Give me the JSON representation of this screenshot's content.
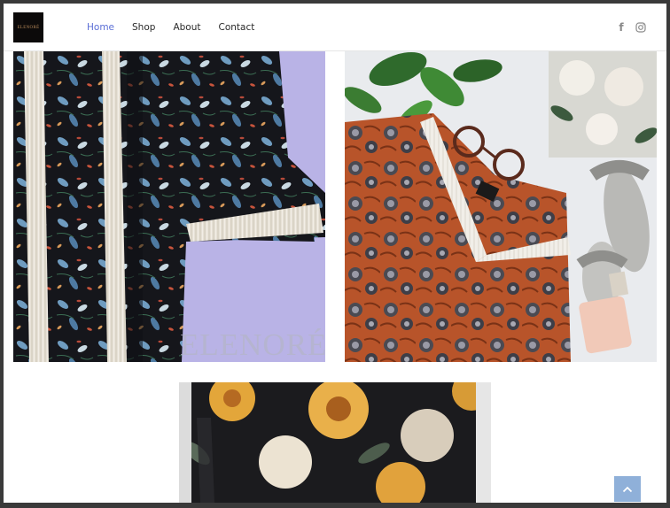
{
  "brand": {
    "logo_text": "ELENORÉ"
  },
  "nav": {
    "items": [
      {
        "label": "Home",
        "active": true
      },
      {
        "label": "Shop",
        "active": false
      },
      {
        "label": "About",
        "active": false
      },
      {
        "label": "Contact",
        "active": false
      }
    ]
  },
  "social": {
    "icons": [
      "facebook-icon",
      "instagram-icon"
    ]
  },
  "products": [
    {
      "name": "black-floral-kimono-with-fringe",
      "watermark": "ELENORÉ"
    },
    {
      "name": "orange-paisley-top-with-fringe-trim"
    },
    {
      "name": "floral-kimono-partial"
    }
  ],
  "colors": {
    "accent": "#5b6fd6",
    "to_top_button": "#8fb0d9",
    "lavender_bg": "#b9b3e6"
  }
}
